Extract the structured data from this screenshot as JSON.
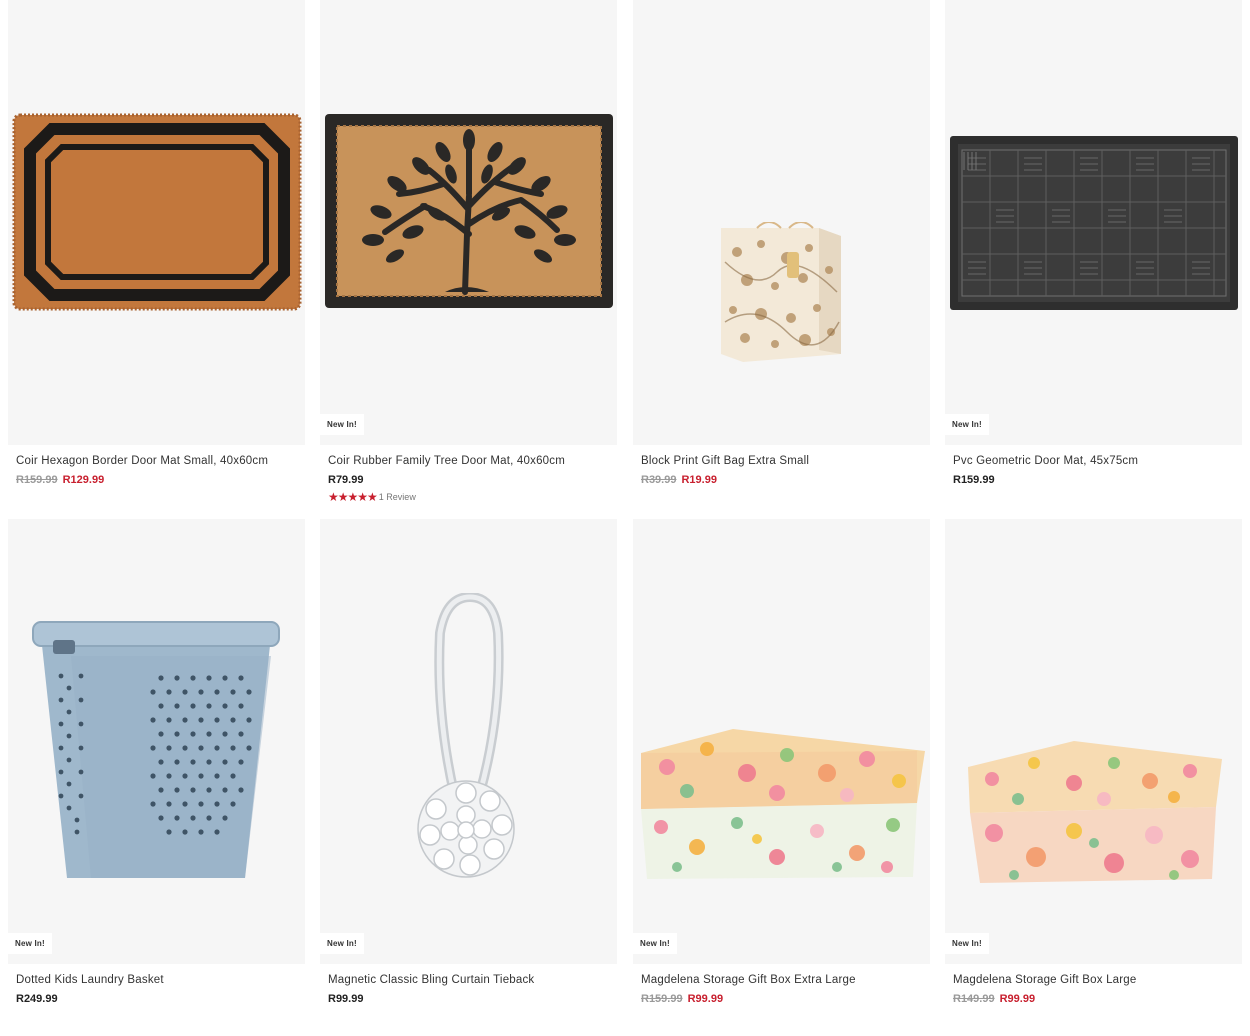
{
  "products": [
    {
      "name": "Coir Hexagon Border Door Mat Small, 40x60cm",
      "old_price": "R159.99",
      "price": "R129.99",
      "badge": "",
      "icon": "coir-hexagon-doormat-image"
    },
    {
      "name": "Coir Rubber Family Tree Door Mat, 40x60cm",
      "old_price": "",
      "price": "R79.99",
      "badge": "New In!",
      "rating_stars": "★★★★★",
      "rating_value": 5,
      "reviews": "1 Review",
      "icon": "tree-doormat-image"
    },
    {
      "name": "Block Print Gift Bag Extra Small",
      "old_price": "R39.99",
      "price": "R19.99",
      "badge": "",
      "icon": "gift-bag-image"
    },
    {
      "name": "Pvc Geometric Door Mat, 45x75cm",
      "old_price": "",
      "price": "R159.99",
      "badge": "New In!",
      "icon": "pvc-doormat-image"
    },
    {
      "name": "Dotted Kids Laundry Basket",
      "old_price": "",
      "price": "R249.99",
      "badge": "New In!",
      "icon": "laundry-basket-image"
    },
    {
      "name": "Magnetic Classic Bling Curtain Tieback",
      "old_price": "",
      "price": "R99.99",
      "badge": "New In!",
      "icon": "curtain-tieback-image"
    },
    {
      "name": "Magdelena Storage Gift Box Extra Large",
      "old_price": "R159.99",
      "price": "R99.99",
      "badge": "New In!",
      "icon": "gift-box-xl-image"
    },
    {
      "name": "Magdelena Storage Gift Box Large",
      "old_price": "R149.99",
      "price": "R99.99",
      "badge": "New In!",
      "icon": "gift-box-large-image"
    }
  ],
  "colors": {
    "sale": "#c8202f",
    "image_bg": "#f6f6f6",
    "text": "#333333"
  }
}
